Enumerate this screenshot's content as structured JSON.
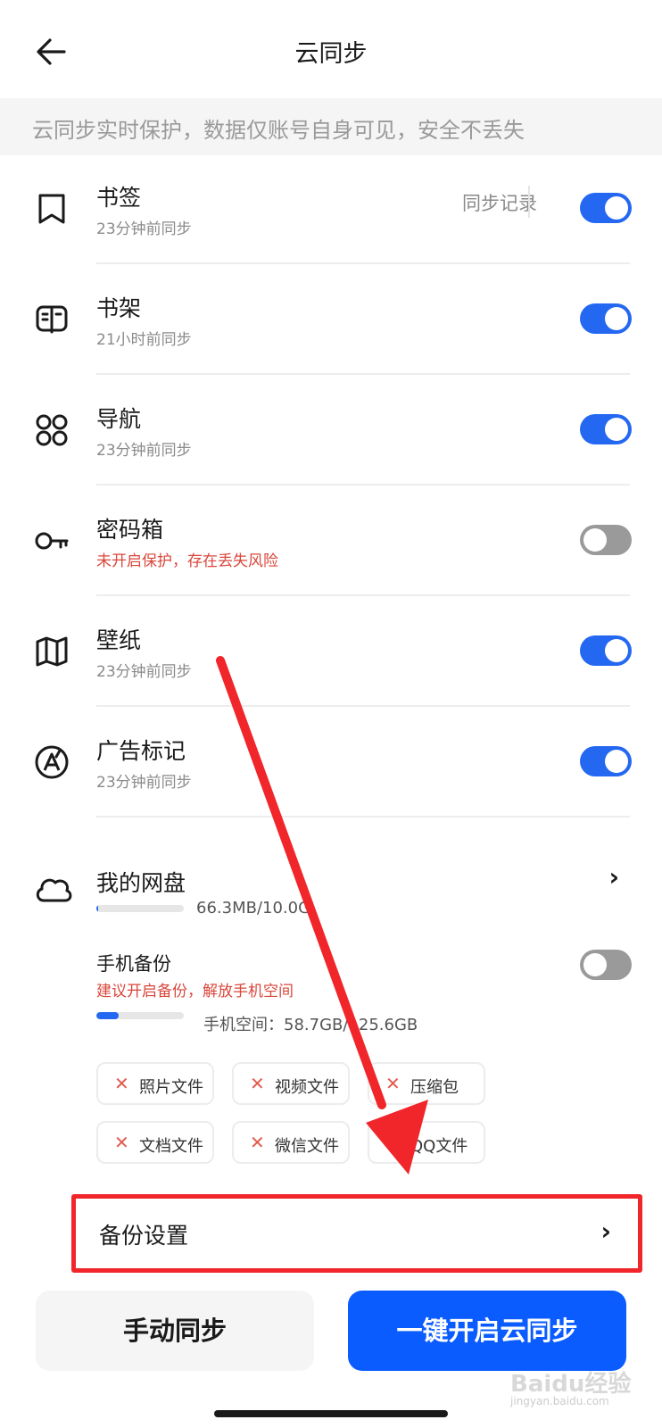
{
  "header": {
    "title": "云同步"
  },
  "banner": {
    "text": "云同步实时保护，数据仅账号自身可见，安全不丢失"
  },
  "items": [
    {
      "name": "书签",
      "status": "23分钟前同步",
      "enabled": true,
      "icon": "bookmark-icon"
    },
    {
      "name": "书架",
      "status": "21小时前同步",
      "enabled": true,
      "icon": "bookshelf-icon"
    },
    {
      "name": "导航",
      "status": "23分钟前同步",
      "enabled": true,
      "icon": "grid-icon"
    },
    {
      "name": "密码箱",
      "status": "未开启保护，存在丢失风险",
      "enabled": false,
      "icon": "key-icon",
      "warning": true
    },
    {
      "name": "壁纸",
      "status": "23分钟前同步",
      "enabled": true,
      "icon": "wallpaper-icon"
    },
    {
      "name": "广告标记",
      "status": "23分钟前同步",
      "enabled": true,
      "icon": "ad-mark-icon"
    }
  ],
  "sync_record_label": "同步记录",
  "disk": {
    "name": "我的网盘",
    "usage": "66.3MB/10.0G",
    "used_fraction": 0.006
  },
  "phone_backup": {
    "name": "手机备份",
    "hint": "建议开启备份，解放手机空间",
    "usage": "手机空间：58.7GB/125.6GB",
    "used_fraction": 0.25,
    "enabled": false
  },
  "file_types": [
    "照片文件",
    "视频文件",
    "压缩包",
    "文档文件",
    "微信文件",
    "QQ文件"
  ],
  "backup_settings": {
    "label": "备份设置"
  },
  "actions": {
    "manual_sync": "手动同步",
    "enable_all": "一键开启云同步"
  },
  "watermark": {
    "brand": "Baidu经验",
    "url": "jingyan.baidu.com"
  },
  "colors": {
    "accent": "#2468f2",
    "primary_button": "#0a5cff",
    "warning": "#d9463b",
    "highlight_box": "#f0262a"
  }
}
